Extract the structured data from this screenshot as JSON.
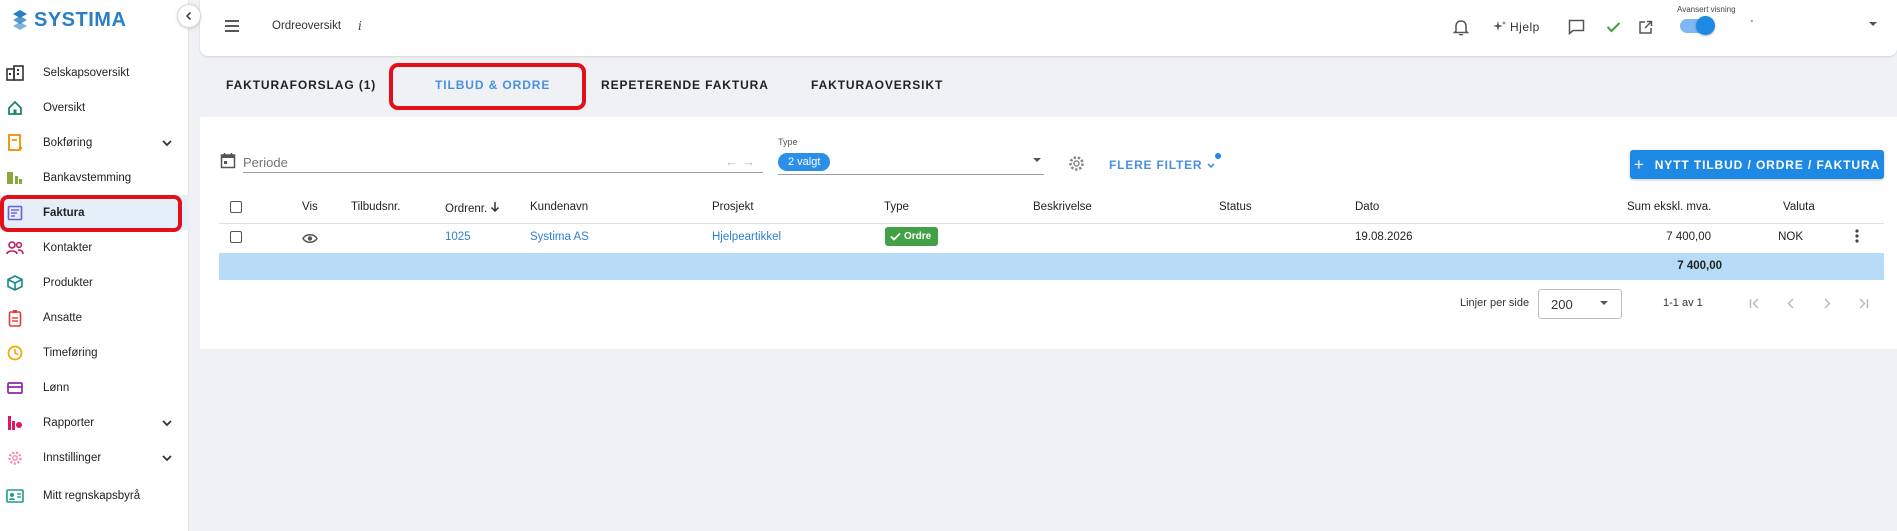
{
  "brand": {
    "name": "SYSTIMA",
    "color": "#2a7fc4"
  },
  "sidebar": {
    "items": [
      {
        "label": "Selskapsoversikt",
        "icon": "buildings-icon",
        "expandable": false
      },
      {
        "label": "Oversikt",
        "icon": "home-icon",
        "expandable": false
      },
      {
        "label": "Bokføring",
        "icon": "ledger-icon",
        "expandable": true
      },
      {
        "label": "Bankavstemming",
        "icon": "bank-icon",
        "expandable": false
      },
      {
        "label": "Faktura",
        "icon": "invoice-icon",
        "expandable": false,
        "active": true
      },
      {
        "label": "Kontakter",
        "icon": "contacts-icon",
        "expandable": false
      },
      {
        "label": "Produkter",
        "icon": "box-icon",
        "expandable": false
      },
      {
        "label": "Ansatte",
        "icon": "id-badge-icon",
        "expandable": false
      },
      {
        "label": "Timeføring",
        "icon": "clock-icon",
        "expandable": false
      },
      {
        "label": "Lønn",
        "icon": "card-icon",
        "expandable": false
      },
      {
        "label": "Rapporter",
        "icon": "report-icon",
        "expandable": true
      },
      {
        "label": "Innstillinger",
        "icon": "gear-icon",
        "expandable": true
      },
      {
        "label": "Mitt regnskapsbyrå",
        "icon": "contact-card-icon",
        "expandable": false
      }
    ]
  },
  "topbar": {
    "title": "Ordreoversikt",
    "info": "i",
    "help_label": "Hjelp",
    "advanced_view_label": "Avansert visning",
    "advanced_view_on": true,
    "user_name": "'"
  },
  "tabs": [
    {
      "label": "FAKTURAFORSLAG (1)",
      "active": false
    },
    {
      "label": "TILBUD & ORDRE",
      "active": true
    },
    {
      "label": "REPETERENDE FAKTURA",
      "active": false
    },
    {
      "label": "FAKTURAOVERSIKT",
      "active": false
    }
  ],
  "filters": {
    "period_placeholder": "Periode",
    "type_label": "Type",
    "type_value": "2 valgt",
    "more_filters_label": "FLERE FILTER"
  },
  "new_button_label": "NYTT TILBUD / ORDRE / FAKTURA",
  "table": {
    "columns": [
      "Vis",
      "Tilbudsnr.",
      "Ordrenr.",
      "Kundenavn",
      "Prosjekt",
      "Type",
      "Beskrivelse",
      "Status",
      "Dato",
      "Sum ekskl. mva.",
      "Valuta"
    ],
    "rows": [
      {
        "tilbudsnr": "",
        "ordrenr": "1025",
        "kundenavn": "Systima AS",
        "prosjekt": "Hjelpeartikkel",
        "type": "Ordre",
        "beskrivelse": "",
        "status": "",
        "dato": "19.08.2026",
        "sum": "7 400,00",
        "valuta": "NOK"
      }
    ],
    "total": "7 400,00"
  },
  "pagination": {
    "rows_per_page_label": "Linjer per side",
    "rows_per_page": "200",
    "range": "1-1 av 1"
  },
  "colors": {
    "accent": "#1e88e5",
    "highlight": "#e3101c",
    "badge_green": "#43a047",
    "sum_row": "#b8dcf7"
  }
}
